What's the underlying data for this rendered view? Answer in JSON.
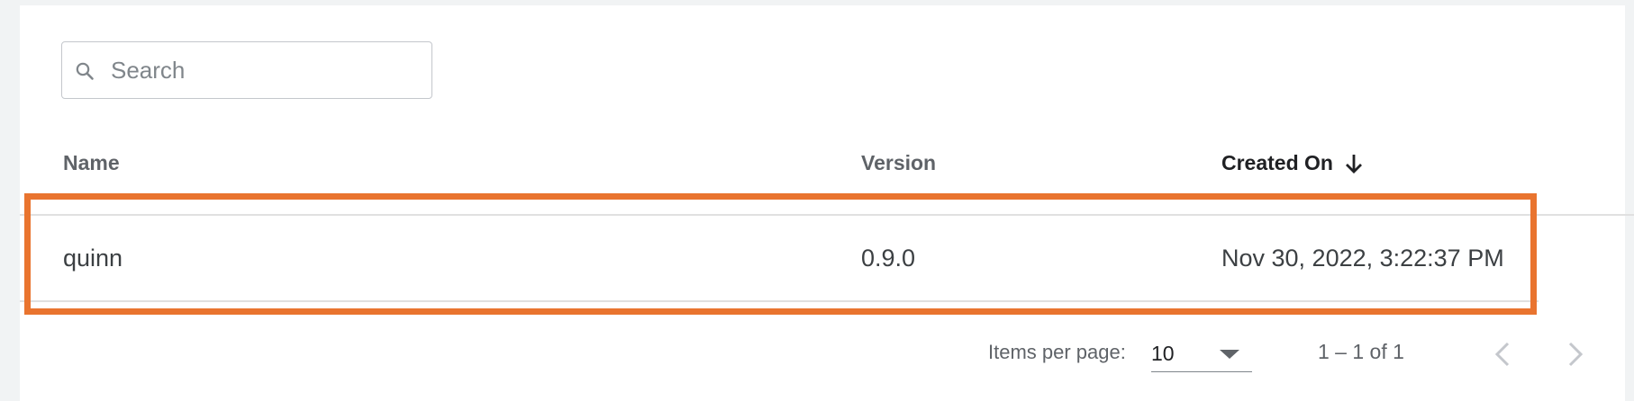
{
  "search": {
    "placeholder": "Search",
    "value": "",
    "icon": "search-icon"
  },
  "table": {
    "columns": [
      {
        "label": "Name"
      },
      {
        "label": "Version"
      },
      {
        "label": "Created On",
        "sorted": "descending",
        "sort_icon": "arrow-down-icon"
      }
    ],
    "rows": [
      {
        "name": "quinn",
        "version": "0.9.0",
        "created_on": "Nov 30, 2022, 3:22:37 PM"
      }
    ]
  },
  "paginator": {
    "items_per_page_label": "Items per page:",
    "items_per_page_value": "10",
    "range_label": "1 – 1 of 1",
    "prev_icon": "chevron-left-icon",
    "next_icon": "chevron-right-icon"
  },
  "colors": {
    "highlight": "#e9742f",
    "header_text": "#5f6368",
    "active_header_text": "#202124",
    "cell_text": "#3c4043"
  }
}
